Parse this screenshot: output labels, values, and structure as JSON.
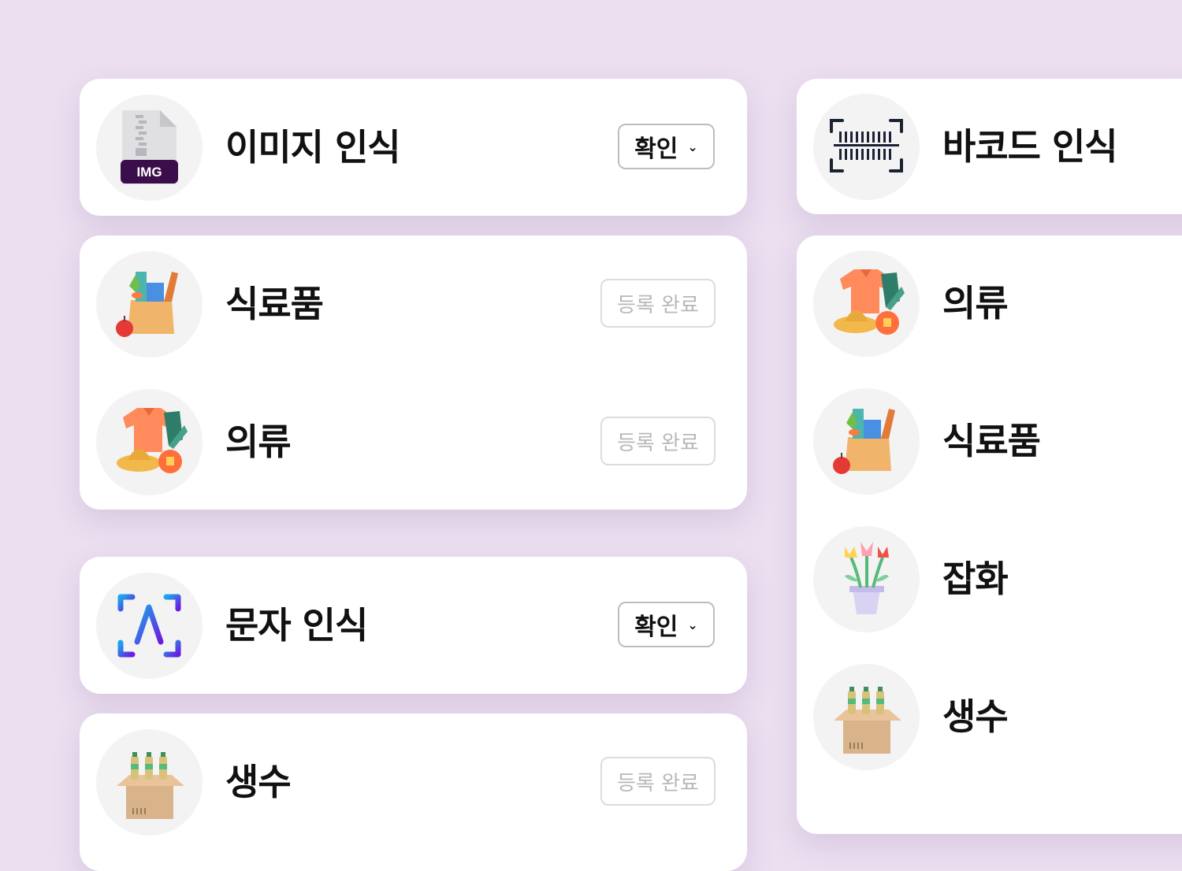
{
  "left_column": {
    "image_recognition": {
      "title": "이미지 인식",
      "button": "확인",
      "icon_label": "IMG"
    },
    "image_items": [
      {
        "label": "식료품",
        "status": "등록 완료"
      },
      {
        "label": "의류",
        "status": "등록 완료"
      }
    ],
    "text_recognition": {
      "title": "문자 인식",
      "button": "확인"
    },
    "text_items": [
      {
        "label": "생수",
        "status": "등록 완료"
      }
    ]
  },
  "right_column": {
    "barcode_recognition": {
      "title": "바코드 인식"
    },
    "barcode_items": [
      {
        "label": "의류"
      },
      {
        "label": "식료품"
      },
      {
        "label": "잡화"
      },
      {
        "label": "생수"
      }
    ]
  },
  "colors": {
    "background": "#ebdff0",
    "card": "#ffffff",
    "icon_circle": "#f3f3f4",
    "img_badge": "#3b0d4a",
    "ocr_gradient_start": "#1aa7ec",
    "ocr_gradient_end": "#6a1be0"
  },
  "icons": [
    "image-file-icon",
    "barcode-scan-icon",
    "text-recognition-icon",
    "grocery-bag-icon",
    "clothing-icon",
    "flower-pot-icon",
    "water-bottles-box-icon",
    "chevron-down-icon"
  ]
}
